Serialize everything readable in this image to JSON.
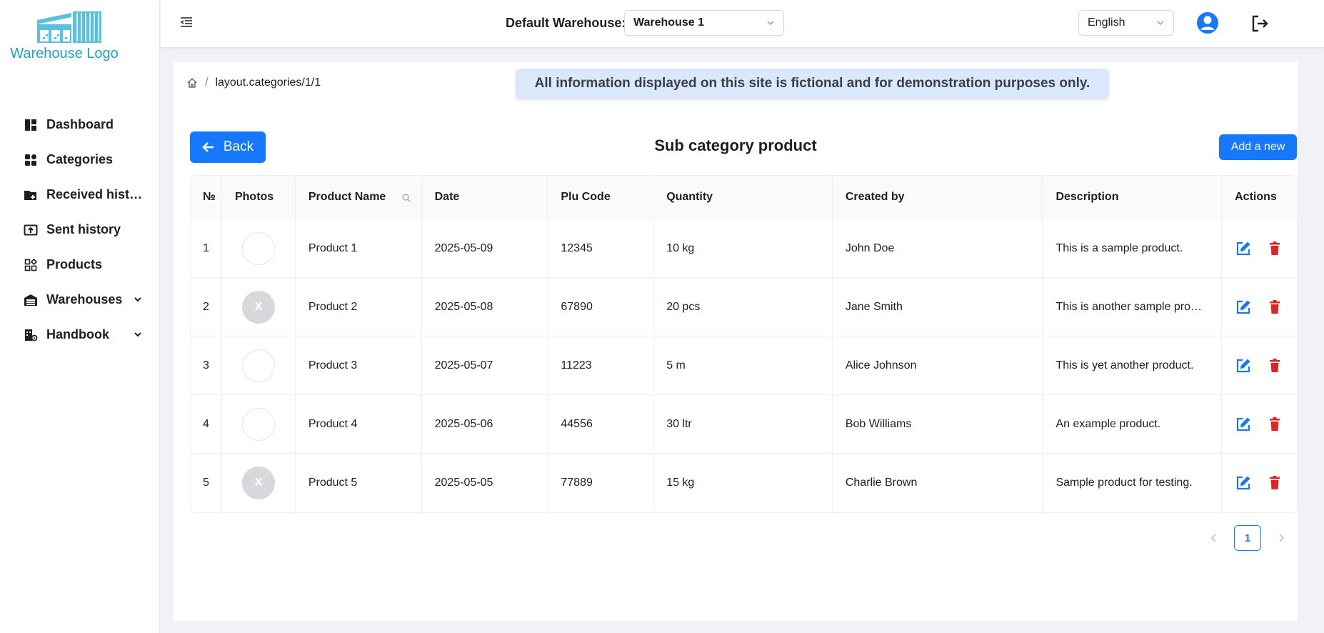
{
  "sidebar": {
    "logo_text": "Warehouse Logo",
    "items": [
      {
        "label": "Dashboard",
        "icon": "dashboard-icon"
      },
      {
        "label": "Categories",
        "icon": "categories-icon"
      },
      {
        "label": "Received histo...",
        "icon": "received-folder-icon"
      },
      {
        "label": "Sent history",
        "icon": "sent-upload-icon"
      },
      {
        "label": "Products",
        "icon": "products-icon"
      },
      {
        "label": "Warehouses",
        "icon": "warehouse-icon",
        "expandable": true
      },
      {
        "label": "Handbook",
        "icon": "handbook-icon",
        "expandable": true
      }
    ]
  },
  "header": {
    "warehouse_label": "Default Warehouse:",
    "warehouse_value": "Warehouse 1",
    "language_value": "English"
  },
  "content": {
    "breadcrumb_path": "layout.categories/1/1",
    "breadcrumb_sep": "/",
    "notice": "All information displayed on this site is fictional and for demonstration purposes only.",
    "back_label": "Back",
    "title": "Sub category product",
    "add_label": "Add a new"
  },
  "table": {
    "headers": [
      "№",
      "Photos",
      "Product Name",
      "Date",
      "Plu Code",
      "Quantity",
      "Created by",
      "Description",
      "Actions"
    ],
    "rows": [
      {
        "no": "1",
        "photo": "",
        "name": "Product 1",
        "date": "2025-05-09",
        "plu": "12345",
        "qty": "10 kg",
        "created_by": "John Doe",
        "description": "This is a sample product."
      },
      {
        "no": "2",
        "photo": "X",
        "name": "Product 2",
        "date": "2025-05-08",
        "plu": "67890",
        "qty": "20 pcs",
        "created_by": "Jane Smith",
        "description": "This is another sample prod..."
      },
      {
        "no": "3",
        "photo": "",
        "name": "Product 3",
        "date": "2025-05-07",
        "plu": "11223",
        "qty": "5 m",
        "created_by": "Alice Johnson",
        "description": "This is yet another product."
      },
      {
        "no": "4",
        "photo": "",
        "name": "Product 4",
        "date": "2025-05-06",
        "plu": "44556",
        "qty": "30 ltr",
        "created_by": "Bob Williams",
        "description": "An example product."
      },
      {
        "no": "5",
        "photo": "X",
        "name": "Product 5",
        "date": "2025-05-05",
        "plu": "77889",
        "qty": "15 kg",
        "created_by": "Charlie Brown",
        "description": "Sample product for testing."
      }
    ]
  },
  "pagination": {
    "current": "1"
  },
  "colors": {
    "primary": "#1677ff",
    "delete": "#e02424",
    "logo": "#1e9fc7",
    "notice_bg": "#dbe8fb"
  }
}
